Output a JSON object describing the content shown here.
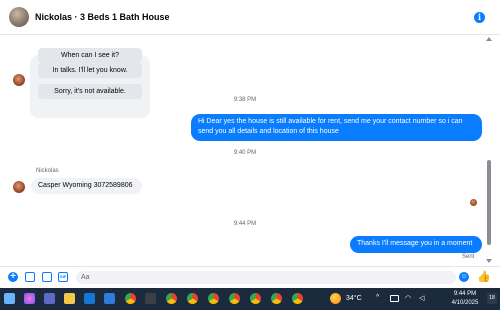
{
  "header": {
    "title": "Nickolas · 3 Beds 1 Bath House"
  },
  "quick_replies": [
    "When can I see it?",
    "In talks. I'll let you know.",
    "Sorry, it's not available."
  ],
  "messages": {
    "time_1": "9:38 PM",
    "outgoing_1": "Hi Dear yes the house is still available for rent, send me your contact number so i can send you all details and location of this house",
    "time_2": "9:40 PM",
    "sender_name": "Nickolas",
    "incoming_1": "Casper Wyoming 3072589806",
    "time_3": "9:44 PM",
    "outgoing_2": "Thanks I'll message you in a moment",
    "status": "Sent"
  },
  "composer": {
    "placeholder": "Aa"
  },
  "taskbar": {
    "temperature": "34°C",
    "time": "9:44 PM",
    "date": "4/10/2025",
    "notification_count": "18"
  },
  "colors": {
    "accent": "#0a7cff",
    "bubble_incoming": "#f0f2f5",
    "taskbar_bg": "#1b2a3c"
  },
  "icons": {
    "info": "info-icon",
    "add": "plus-circle-icon",
    "photo": "photo-icon",
    "sticker": "sticker-icon",
    "gif": "gif-icon",
    "emoji": "emoji-icon",
    "like": "thumbs-up-icon"
  }
}
